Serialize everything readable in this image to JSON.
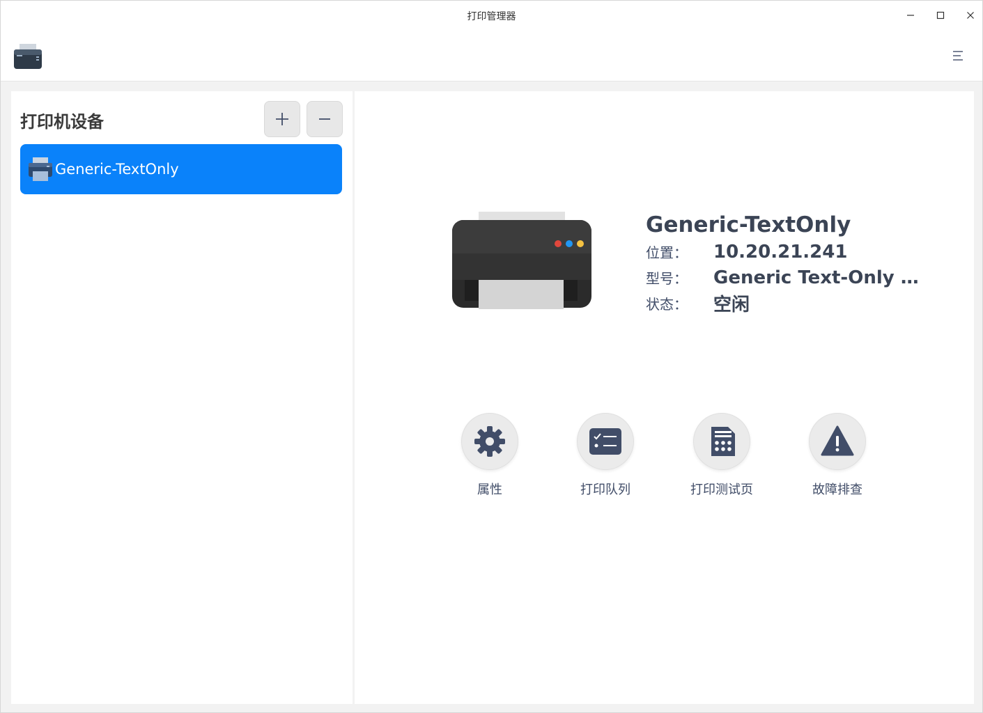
{
  "window": {
    "title": "打印管理器"
  },
  "sidebar": {
    "title": "打印机设备",
    "add_icon": "plus-icon",
    "remove_icon": "minus-icon",
    "printers": [
      {
        "label": "Generic-TextOnly",
        "selected": true
      }
    ]
  },
  "details": {
    "name": "Generic-TextOnly",
    "location_label": "位置：",
    "location_value": "10.20.21.241",
    "model_label": "型号：",
    "model_value": "Generic Text-Only …",
    "status_label": "状态：",
    "status_value": "空闲"
  },
  "actions": [
    {
      "label": "属性",
      "icon": "gear-icon"
    },
    {
      "label": "打印队列",
      "icon": "queue-list-icon"
    },
    {
      "label": "打印测试页",
      "icon": "test-page-icon"
    },
    {
      "label": "故障排查",
      "icon": "warning-icon"
    }
  ],
  "colors": {
    "accent": "#0a82fa",
    "icon_dark": "#414d68"
  }
}
